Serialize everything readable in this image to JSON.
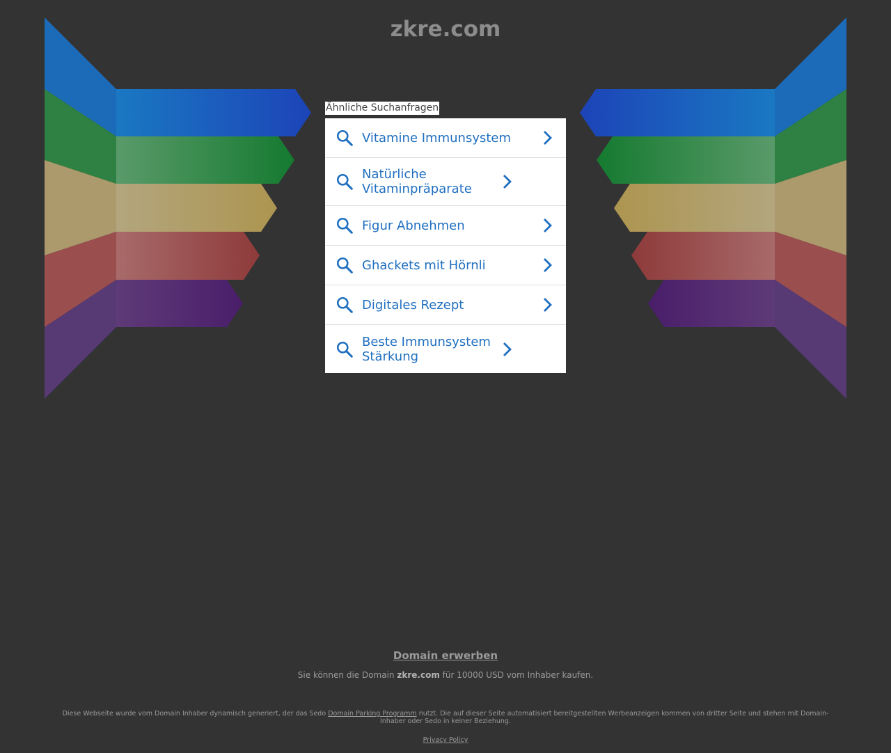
{
  "header": {
    "domain_title": "zkre.com"
  },
  "related": {
    "label": "Ähnliche Suchanfragen",
    "items": [
      {
        "label": "Vitamine Immunsystem"
      },
      {
        "label": "Natürliche Vitaminpräparate"
      },
      {
        "label": "Figur Abnehmen"
      },
      {
        "label": "Ghackets mit Hörnli"
      },
      {
        "label": "Digitales Rezept"
      },
      {
        "label": "Beste Immunsystem Stärkung"
      }
    ]
  },
  "footer": {
    "buy_link": "Domain erwerben",
    "offer_prefix": "Sie können die Domain",
    "offer_domain": "zkre.com",
    "offer_suffix": "für 10000 USD vom Inhaber kaufen.",
    "disclaimer_prefix": "Diese Webseite wurde vom Domain Inhaber dynamisch generiert, der das Sedo",
    "disclaimer_link": "Domain Parking Programm",
    "disclaimer_suffix": "nutzt. Die auf dieser Seite automatisiert bereitgestellten Werbeanzeigen kommen von dritter Seite und stehen mit Domain-Inhaber oder Sedo in keiner Beziehung.",
    "privacy_link": "Privacy Policy"
  },
  "colors": {
    "background": "#333333",
    "link_blue": "#1f6fc0",
    "band_blue": "#1c4fb8",
    "band_green": "#1e7a34",
    "band_tan": "#b09a5e",
    "band_red": "#9a4a4a",
    "band_purple": "#4e2a6e"
  }
}
